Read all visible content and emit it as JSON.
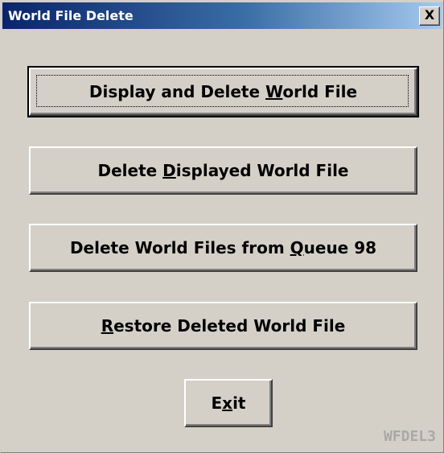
{
  "window": {
    "title": "World File Delete",
    "close_glyph": "X",
    "screen_code": "WFDEL3"
  },
  "buttons": {
    "display_delete": {
      "pre": "Display and Delete ",
      "access": "W",
      "post": "orld File"
    },
    "delete_displayed": {
      "pre": "Delete ",
      "access": "D",
      "post": "isplayed World File"
    },
    "delete_queue": {
      "pre": "Delete World Files from ",
      "access": "Q",
      "post": "ueue 98"
    },
    "restore": {
      "pre": "",
      "access": "R",
      "post": "estore Deleted World File"
    },
    "exit": {
      "pre": "E",
      "access": "x",
      "post": "it"
    }
  },
  "colors": {
    "face": "#d4d0c8",
    "title_start": "#0a246a",
    "title_end": "#a6caf0",
    "code_text": "#a8a8a8"
  },
  "icons": {
    "close": "close-icon"
  }
}
